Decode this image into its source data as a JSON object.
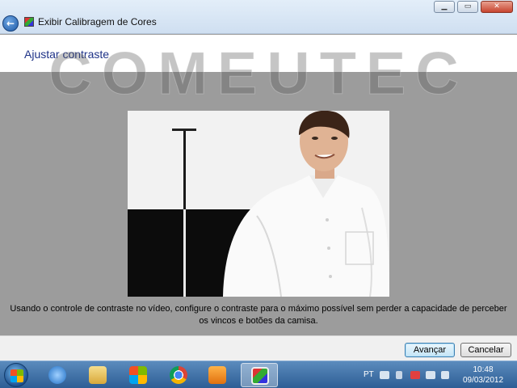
{
  "window": {
    "title": "Exibir Calibragem de Cores",
    "controls": {
      "minimize": "▁",
      "maximize": "▭",
      "close": "✕"
    }
  },
  "header": {
    "heading": "Ajustar contraste"
  },
  "watermark": {
    "text": "COMEUTEC"
  },
  "main": {
    "instructions": "Usando o controle de contraste no vídeo, configure o contraste para o máximo possível sem perder a capacidade de perceber os vincos e botões da camisa."
  },
  "footer": {
    "next_label": "Avançar",
    "cancel_label": "Cancelar"
  },
  "taskbar": {
    "pinned": [
      {
        "name": "internet-explorer-icon",
        "color": "#3a8de0"
      },
      {
        "name": "file-explorer-icon",
        "color": "#e9c45a"
      },
      {
        "name": "windows-logo-icon",
        "color": "#4aa35a"
      },
      {
        "name": "chrome-icon",
        "color": "#db4437"
      },
      {
        "name": "media-player-icon",
        "color": "#f08a1c"
      },
      {
        "name": "color-calibration-icon",
        "color": "#5aa0e6"
      }
    ],
    "tray": {
      "language": "PT",
      "time": "10:48",
      "date": "09/03/2012"
    }
  },
  "colors": {
    "heading": "#1e3287",
    "title_bar": "#dbe8f6",
    "background": "#9c9c9c"
  }
}
